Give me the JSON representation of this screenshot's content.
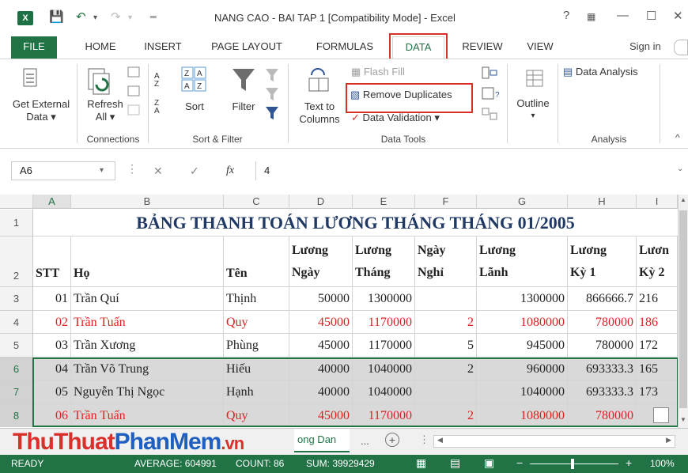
{
  "window": {
    "title": "NANG CAO - BAI TAP 1  [Compatibility Mode] - Excel",
    "help": "?",
    "minimize": "—",
    "maximize": "☐",
    "close": "✕"
  },
  "tabs": [
    "FILE",
    "HOME",
    "INSERT",
    "PAGE LAYOUT",
    "FORMULAS",
    "DATA",
    "REVIEW",
    "VIEW"
  ],
  "signin": "Sign in",
  "ribbon": {
    "get_external_1": "Get External",
    "get_external_2": "Data ▾",
    "refresh_1": "Refresh",
    "refresh_2": "All ▾",
    "sort": "Sort",
    "filter": "Filter",
    "text_to_1": "Text to",
    "text_to_2": "Columns",
    "flash_fill": "Flash Fill",
    "remove_duplicates": "Remove Duplicates",
    "data_validation": "Data Validation  ▾",
    "outline": "Outline",
    "data_analysis": "Data Analysis",
    "group_connections": "Connections",
    "group_sort_filter": "Sort & Filter",
    "group_data_tools": "Data Tools",
    "group_analysis": "Analysis"
  },
  "formula_bar": {
    "name_box": "A6",
    "fx": "fx",
    "value": "4"
  },
  "columns": [
    "A",
    "B",
    "C",
    "D",
    "E",
    "F",
    "G",
    "H",
    "I"
  ],
  "sheet_title": "BẢNG THANH TOÁN LƯƠNG THÁNG THÁNG 01/2005",
  "headers": {
    "stt": "STT",
    "ho": "Họ",
    "ten": "Tên",
    "luong_ngay_1": "Lương",
    "luong_ngay_2": "Ngày",
    "luong_thang_1": "Lương",
    "luong_thang_2": "Tháng",
    "ngay_nghi_1": "Ngày",
    "ngay_nghi_2": "Nghỉ",
    "luong_lanh_1": "Lương",
    "luong_lanh_2": "Lãnh",
    "luong_ky1_1": "Lương",
    "luong_ky1_2": "Kỳ 1",
    "luong_ky2_1": "Lươn",
    "luong_ky2_2": "Kỳ 2"
  },
  "rows": [
    {
      "n": "3",
      "stt": "01",
      "ho": "Trần Quí",
      "ten": "Thịnh",
      "lng": "50000",
      "lt": "1300000",
      "nn": "",
      "ll": "1300000",
      "k1": "866666.7",
      "k2": "216",
      "red": false,
      "sel": false
    },
    {
      "n": "4",
      "stt": "02",
      "ho": "Trần Tuấn",
      "ten": "Quy",
      "lng": "45000",
      "lt": "1170000",
      "nn": "2",
      "ll": "1080000",
      "k1": "780000",
      "k2": "186",
      "red": true,
      "sel": false
    },
    {
      "n": "5",
      "stt": "03",
      "ho": "Trần Xương",
      "ten": "Phùng",
      "lng": "45000",
      "lt": "1170000",
      "nn": "5",
      "ll": "945000",
      "k1": "780000",
      "k2": "172",
      "red": false,
      "sel": false
    },
    {
      "n": "6",
      "stt": "04",
      "ho": "Trần Võ Trung",
      "ten": "Hiếu",
      "lng": "40000",
      "lt": "1040000",
      "nn": "2",
      "ll": "960000",
      "k1": "693333.3",
      "k2": "165",
      "red": false,
      "sel": true
    },
    {
      "n": "7",
      "stt": "05",
      "ho": "Nguyễn Thị Ngọc",
      "ten": "Hạnh",
      "lng": "40000",
      "lt": "1040000",
      "nn": "",
      "ll": "1040000",
      "k1": "693333.3",
      "k2": "173",
      "red": false,
      "sel": true
    },
    {
      "n": "8",
      "stt": "06",
      "ho": "Trần Tuấn",
      "ten": "Quy",
      "lng": "45000",
      "lt": "1170000",
      "nn": "2",
      "ll": "1080000",
      "k1": "780000",
      "k2": "",
      "red": true,
      "sel": true
    }
  ],
  "sheet_tab": "ong Dan",
  "sheet_more": "...",
  "watermark": {
    "part1": "ThuThuat",
    "part2": "PhanMem",
    "part3": ".vn"
  },
  "status": {
    "ready": "READY",
    "average": "AVERAGE: 604991",
    "count": "COUNT: 86",
    "sum": "SUM: 39929429",
    "zoom": "100%"
  }
}
